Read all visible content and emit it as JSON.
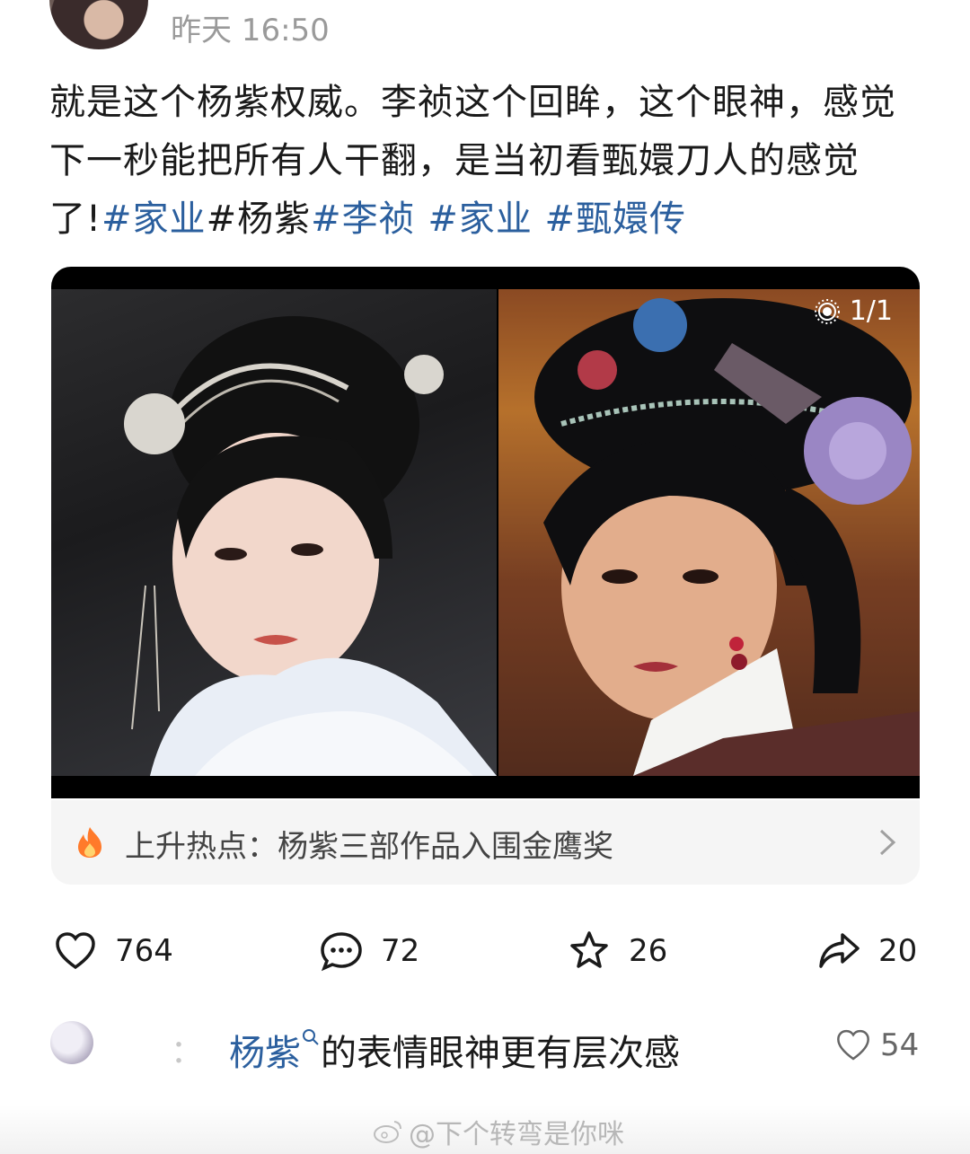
{
  "header": {
    "timestamp": "昨天 16:50"
  },
  "post": {
    "text_plain": "就是这个杨紫权威。李祯这个回眸，这个眼神，感觉下一秒能把所有人干翻，是当初看甄嬛刀人的感觉了!",
    "hashtags": [
      "#家业",
      "#杨紫",
      "#李祯",
      "#家业",
      "#甄嬛传"
    ],
    "image_counter": "1/1"
  },
  "hot_topic": {
    "label": "上升热点：杨紫三部作品入围金鹰奖"
  },
  "actions": {
    "likes": "764",
    "comments": "72",
    "favorites": "26",
    "shares": "20"
  },
  "top_comment": {
    "username": "：",
    "mention": "杨紫",
    "text": "的表情眼神更有层次感",
    "likes": "54"
  },
  "watermark": {
    "text": "@下个转弯是你咪"
  },
  "colors": {
    "hashtag": "#2b5f9e",
    "timestamp": "#9a9a9a",
    "hot_bar_bg": "#f5f5f5"
  }
}
